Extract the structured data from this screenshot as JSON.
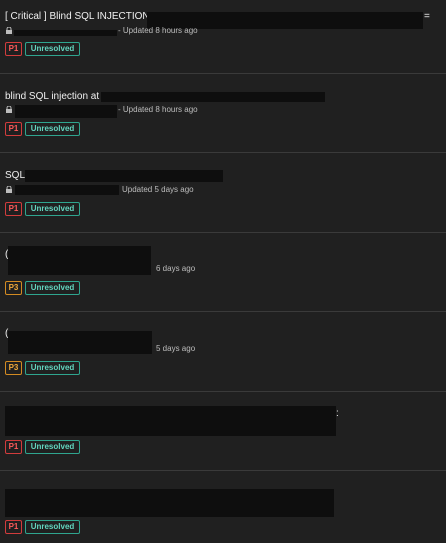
{
  "reports": [
    {
      "title": "[ Critical ] Blind SQL INJECTION",
      "title_suffix": "=",
      "meta": "- Updated 8 hours ago",
      "priority": "P1",
      "status": "Unresolved"
    },
    {
      "title": "blind SQL injection at",
      "title_suffix": "",
      "meta": "- Updated 8 hours ago",
      "priority": "P1",
      "status": "Unresolved"
    },
    {
      "title": "SQLi",
      "title_suffix": "",
      "meta": "Updated 5 days ago",
      "priority": "P1",
      "status": "Unresolved"
    },
    {
      "title": "(",
      "title_suffix": "",
      "meta": "6 days ago",
      "priority": "P3",
      "status": "Unresolved"
    },
    {
      "title": "(",
      "title_suffix": "",
      "meta": "5 days ago",
      "priority": "P3",
      "status": "Unresolved"
    },
    {
      "title": "",
      "title_suffix": ":",
      "meta": "",
      "priority": "P1",
      "status": "Unresolved"
    },
    {
      "title": "",
      "title_suffix": "",
      "meta": "",
      "priority": "P1",
      "status": "Unresolved"
    }
  ],
  "colors": {
    "background": "#202020",
    "separator": "#3a3a3a",
    "p1": "#ff5a5a",
    "p3": "#f0a838",
    "status": "#63d6c0",
    "redaction": "#0e0e0e"
  },
  "icons": {
    "lock": "lock-icon"
  }
}
